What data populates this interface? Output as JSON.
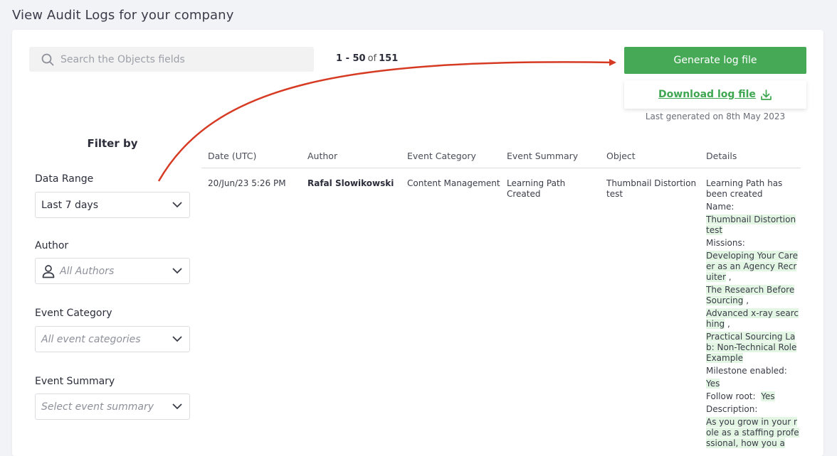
{
  "page": {
    "title": "View Audit Logs for your company"
  },
  "search": {
    "placeholder": "Search the Objects fields"
  },
  "pagination": {
    "range": "1 - 50",
    "of": "of",
    "total": "151"
  },
  "actions": {
    "generate_label": "Generate log file",
    "download_label": "Download log file",
    "last_generated": "Last generated on 8th May 2023"
  },
  "filters": {
    "title": "Filter by",
    "date_range": {
      "label": "Data Range",
      "value": "Last 7 days"
    },
    "author": {
      "label": "Author",
      "placeholder": "All Authors"
    },
    "event_category": {
      "label": "Event Category",
      "placeholder": "All event categories"
    },
    "event_summary": {
      "label": "Event Summary",
      "placeholder": "Select event summary"
    }
  },
  "table": {
    "columns": [
      "Date (UTC)",
      "Author",
      "Event Category",
      "Event Summary",
      "Object",
      "Details"
    ],
    "rows": [
      {
        "date": "20/Jun/23 5:26 PM",
        "author": "Rafal Slowikowski",
        "category": "Content Management",
        "summary": "Learning Path Created",
        "object": "Thumbnail Distortion test",
        "details": {
          "intro": "Learning Path has been created",
          "name_label": "Name:",
          "name_value": "Thumbnail Distortion test",
          "missions_label": "Missions:",
          "missions": [
            "Developing Your Career as an Agency Recruiter",
            "The Research Before Sourcing",
            "Advanced x-ray searching",
            "Practical Sourcing Lab: Non-Technical Role Example"
          ],
          "sep": ",",
          "milestone_label": "Milestone enabled:",
          "milestone_value": "Yes",
          "follow_label": "Follow root:",
          "follow_value": "Yes",
          "description_label": "Description:",
          "description_value": "As you grow in your role as a staffing professional, how you a"
        }
      }
    ]
  },
  "colors": {
    "accent": "#45a956",
    "link": "#3fa651",
    "highlight": "#e3f5e3",
    "annotation_arrow": "#d63a22"
  }
}
